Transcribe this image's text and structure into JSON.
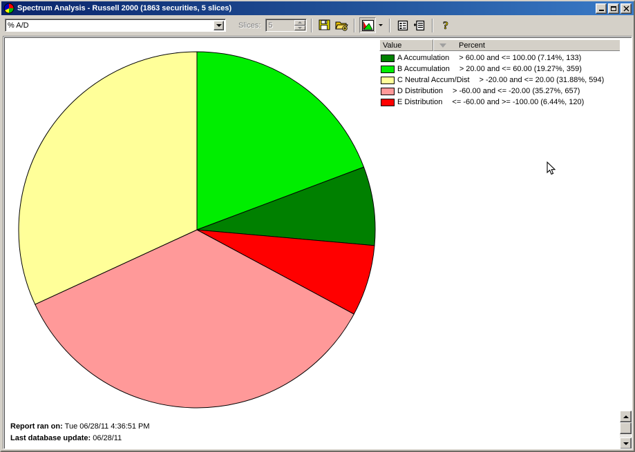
{
  "window": {
    "title": "Spectrum Analysis - Russell 2000 (1863 securities, 5 slices)",
    "app_icon": "pie-chart-icon",
    "minimize_label": "_",
    "maximize_label": "□",
    "close_label": "✕"
  },
  "toolbar": {
    "indicator_value": "% A/D",
    "indicator_options": [
      "% A/D"
    ],
    "slices_label": "Slices:",
    "slices_value": "5",
    "buttons": [
      {
        "name": "save-button",
        "icon": "floppy-disk-icon",
        "tooltip": "Save"
      },
      {
        "name": "open-button",
        "icon": "open-folder-add-icon",
        "tooltip": "Open"
      },
      {
        "name": "chart-type-button",
        "icon": "area-chart-icon",
        "tooltip": "Chart Type"
      },
      {
        "name": "chart-type-dropdown",
        "icon": "chevron-down-icon",
        "tooltip": "Chart Type Options"
      },
      {
        "name": "report-list-button",
        "icon": "list-report-icon",
        "tooltip": "Report"
      },
      {
        "name": "detail-report-button",
        "icon": "detail-report-icon",
        "tooltip": "Detail Report"
      },
      {
        "name": "help-button",
        "icon": "question-mark-icon",
        "tooltip": "Help"
      }
    ]
  },
  "legend": {
    "columns": [
      "Value",
      "Percent"
    ],
    "sort_indicator": "descending",
    "rows": [
      {
        "color": "#008000",
        "name": "A Accumulation",
        "desc": "> 60.00 and <= 100.00 (7.14%, 133)"
      },
      {
        "color": "#00ee00",
        "name": "B Accumulation",
        "desc": "> 20.00 and <= 60.00 (19.27%, 359)"
      },
      {
        "color": "#ffff99",
        "name": "C Neutral Accum/Dist",
        "desc": "> -20.00 and <= 20.00 (31.88%, 594)"
      },
      {
        "color": "#ff9999",
        "name": "D Distribution",
        "desc": "> -60.00 and <= -20.00 (35.27%, 657)"
      },
      {
        "color": "#ff0000",
        "name": "E Distribution",
        "desc": "<= -60.00 and >= -100.00 (6.44%, 120)"
      }
    ]
  },
  "footer": {
    "report_label": "Report ran on:",
    "report_value": "Tue 06/28/11 4:36:51 PM",
    "update_label": "Last database update:",
    "update_value": "06/28/11"
  },
  "chart_data": {
    "type": "pie",
    "title": "Spectrum Analysis - Russell 2000",
    "total_securities": 1863,
    "slice_count": 5,
    "start_angle_deg": 0,
    "direction": "clockwise",
    "legend_position": "right",
    "categories": [
      "A Accumulation",
      "B Accumulation",
      "C Neutral Accum/Dist",
      "D Distribution",
      "E Distribution"
    ],
    "values": [
      7.14,
      19.27,
      31.88,
      35.27,
      6.44
    ],
    "counts": [
      133,
      359,
      594,
      657,
      120
    ],
    "colors": [
      "#008000",
      "#00ee00",
      "#ffff99",
      "#ff9999",
      "#ff0000"
    ],
    "ranges": [
      "> 60.00 and <= 100.00",
      "> 20.00 and <= 60.00",
      "> -20.00 and <= 20.00",
      "> -60.00 and <= -20.00",
      "<= -60.00 and >= -100.00"
    ],
    "ylabel": "Percent",
    "xlabel": "Value"
  }
}
